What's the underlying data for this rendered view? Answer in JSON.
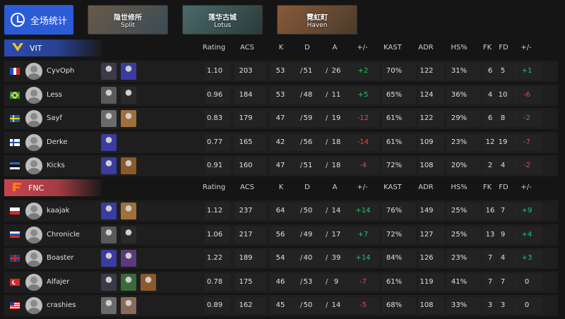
{
  "topbar": {
    "overall_label": "全场统计",
    "maps": [
      {
        "cn": "隐世修所",
        "en": "Split",
        "colors": [
          "#6a5a4a",
          "#3a4a55"
        ]
      },
      {
        "cn": "莲华古城",
        "en": "Lotus",
        "colors": [
          "#4a6a6a",
          "#2a3a3a"
        ]
      },
      {
        "cn": "霓虹町",
        "en": "Haven",
        "colors": [
          "#8a5a3a",
          "#4a3a2a"
        ]
      }
    ]
  },
  "headers": {
    "rating": "Rating",
    "acs": "ACS",
    "k": "K",
    "d": "D",
    "a": "A",
    "pm": "+/-",
    "kast": "KAST",
    "adr": "ADR",
    "hs": "HS%",
    "fk": "FK",
    "fd": "FD",
    "fpm": "+/-"
  },
  "teams": [
    {
      "name": "VIT",
      "color": "#2b4bb0",
      "players": [
        {
          "flag": "fr",
          "name": "CyvOph",
          "agents": [
            "#3a3a4a",
            "#3a3ca0"
          ],
          "rating": "1.10",
          "acs": "203",
          "k": "53",
          "d": "51",
          "a": "26",
          "pm": "+2",
          "kast": "70%",
          "adr": "122",
          "hs": "31%",
          "fk": "6",
          "fd": "5",
          "fpm": "+1"
        },
        {
          "flag": "br",
          "name": "Less",
          "agents": [
            "#5a5a5a",
            "#2a2a2a"
          ],
          "rating": "0.96",
          "acs": "184",
          "k": "53",
          "d": "48",
          "a": "11",
          "pm": "+5",
          "kast": "65%",
          "adr": "124",
          "hs": "36%",
          "fk": "4",
          "fd": "10",
          "fpm": "-6"
        },
        {
          "flag": "se",
          "name": "Sayf",
          "agents": [
            "#6a6a6a",
            "#a0703a"
          ],
          "rating": "0.83",
          "acs": "179",
          "k": "47",
          "d": "59",
          "a": "19",
          "pm": "-12",
          "kast": "61%",
          "adr": "122",
          "hs": "29%",
          "fk": "6",
          "fd": "8",
          "fpm": "-2"
        },
        {
          "flag": "fi",
          "name": "Derke",
          "agents": [
            "#3a3ca0"
          ],
          "rating": "0.77",
          "acs": "165",
          "k": "42",
          "d": "56",
          "a": "18",
          "pm": "-14",
          "kast": "61%",
          "adr": "109",
          "hs": "23%",
          "fk": "12",
          "fd": "19",
          "fpm": "-7"
        },
        {
          "flag": "ee",
          "name": "Kicks",
          "agents": [
            "#3a3ca0",
            "#8a5a2a"
          ],
          "rating": "0.91",
          "acs": "160",
          "k": "47",
          "d": "51",
          "a": "18",
          "pm": "-4",
          "kast": "72%",
          "adr": "108",
          "hs": "20%",
          "fk": "2",
          "fd": "4",
          "fpm": "-2"
        }
      ]
    },
    {
      "name": "FNC",
      "color": "#c8444e",
      "players": [
        {
          "flag": "pl",
          "name": "kaajak",
          "agents": [
            "#3a3ca0",
            "#a0703a"
          ],
          "rating": "1.12",
          "acs": "237",
          "k": "64",
          "d": "50",
          "a": "14",
          "pm": "+14",
          "kast": "76%",
          "adr": "149",
          "hs": "25%",
          "fk": "16",
          "fd": "7",
          "fpm": "+9"
        },
        {
          "flag": "ru",
          "name": "Chronicle",
          "agents": [
            "#5a5a5a",
            "#2a2a2a"
          ],
          "rating": "1.06",
          "acs": "217",
          "k": "56",
          "d": "49",
          "a": "17",
          "pm": "+7",
          "kast": "72%",
          "adr": "127",
          "hs": "25%",
          "fk": "13",
          "fd": "9",
          "fpm": "+4"
        },
        {
          "flag": "gb",
          "name": "Boaster",
          "agents": [
            "#3a3ca0",
            "#5a3a7a"
          ],
          "rating": "1.22",
          "acs": "189",
          "k": "54",
          "d": "40",
          "a": "39",
          "pm": "+14",
          "kast": "84%",
          "adr": "126",
          "hs": "23%",
          "fk": "7",
          "fd": "4",
          "fpm": "+3"
        },
        {
          "flag": "tr",
          "name": "Alfajer",
          "agents": [
            "#3a3a4a",
            "#3a6a3a",
            "#8a5a2a"
          ],
          "rating": "0.78",
          "acs": "175",
          "k": "46",
          "d": "53",
          "a": "9",
          "pm": "-7",
          "kast": "61%",
          "adr": "119",
          "hs": "41%",
          "fk": "7",
          "fd": "7",
          "fpm": "0"
        },
        {
          "flag": "us",
          "name": "crashies",
          "agents": [
            "#6a6a6a",
            "#8a6a5a"
          ],
          "rating": "0.89",
          "acs": "162",
          "k": "45",
          "d": "50",
          "a": "14",
          "pm": "-5",
          "kast": "68%",
          "adr": "108",
          "hs": "33%",
          "fk": "3",
          "fd": "3",
          "fpm": "0"
        }
      ]
    }
  ]
}
